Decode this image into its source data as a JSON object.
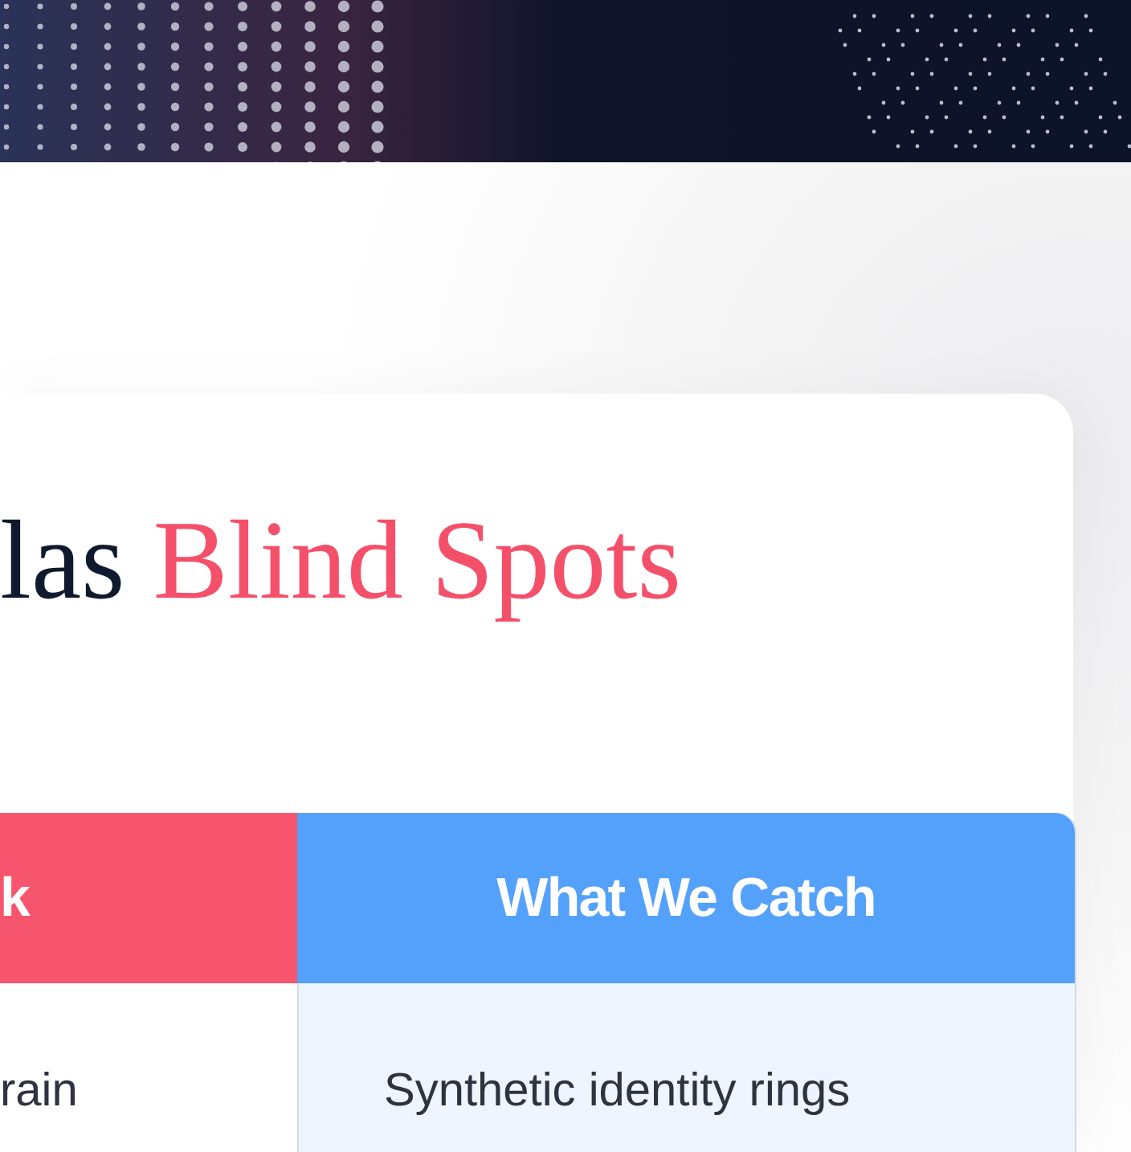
{
  "heading": {
    "lead": "las",
    "accent": "Blind Spots"
  },
  "table": {
    "columns": [
      {
        "label": "k",
        "kind": "miss"
      },
      {
        "label": "What We Catch",
        "kind": "catch"
      }
    ],
    "rows": [
      [
        "rain",
        "Synthetic identity rings"
      ]
    ]
  }
}
